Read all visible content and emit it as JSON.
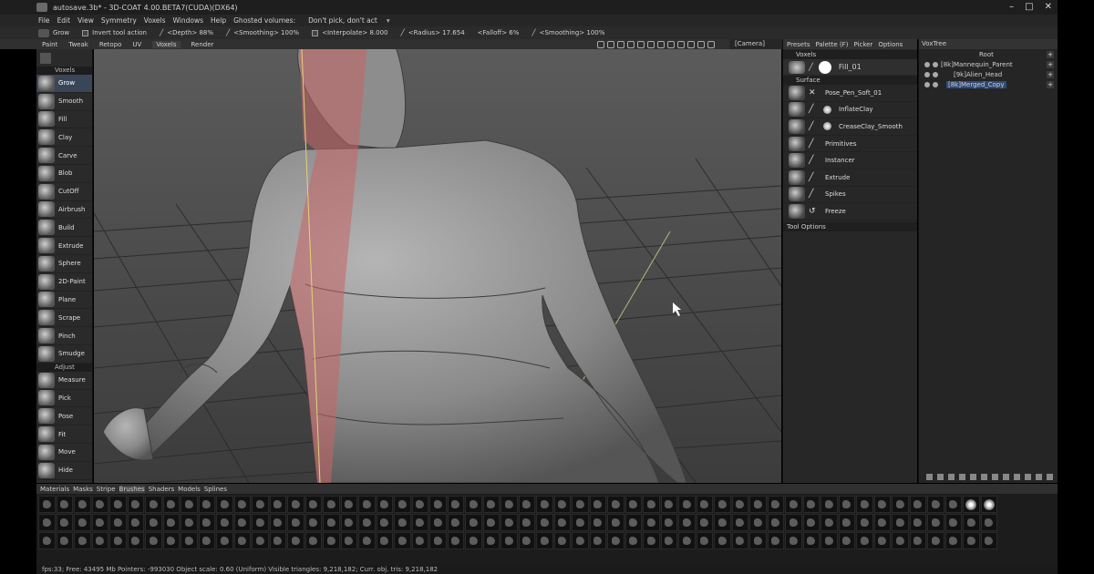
{
  "titlebar": {
    "title": "autosave.3b* - 3D-COAT 4.00.BETA7(CUDA)(DX64)",
    "minimize": "–",
    "maximize": "□",
    "close": "✕"
  },
  "menu": {
    "items": [
      "File",
      "Edit",
      "View",
      "Symmetry",
      "Voxels",
      "Windows",
      "Help"
    ],
    "ghosted_label": "Ghosted volumes:",
    "ghosted_value": "Don't pick, don't act"
  },
  "tool_options": {
    "tool_name": "Grow",
    "invert": "Invert tool action",
    "depth": "<Depth> 88%",
    "smoothing": "<Smoothing> 100%",
    "interpolate": "<Interpolate> 8.000",
    "radius": "<Radius> 17.654",
    "falloff": "<Falloff> 6%",
    "smoothing2": "<Smoothing> 100%"
  },
  "room_tabs": [
    "Paint",
    "Tweak",
    "Retopo",
    "UV",
    "Voxels",
    "Render"
  ],
  "camera": "[Camera]",
  "left_panel": {
    "voxels_header": "Voxels",
    "voxel_tools": [
      "Grow",
      "Smooth",
      "Fill",
      "Clay",
      "Carve",
      "Blob",
      "CutOff",
      "Airbrush",
      "Build",
      "Extrude",
      "Sphere",
      "2D-Paint",
      "Plane",
      "Scrape",
      "Pinch",
      "Smudge"
    ],
    "adjust_header": "Adjust",
    "adjust_tools": [
      "Measure",
      "Pick",
      "Pose",
      "Fit",
      "Move",
      "Hide"
    ]
  },
  "right_panel": {
    "tabs": [
      "Presets",
      "Palette (F)",
      "Picker",
      "Options"
    ],
    "voxels_header": "Voxels",
    "fill_label": "Fill_01",
    "surface_header": "Surface",
    "brushes": [
      "Pose_Pen_Soft_01",
      "InflateClay",
      "CreaseClay_Smooth",
      "Primitives",
      "Instancer",
      "Extrude",
      "Spikes",
      "Freeze"
    ],
    "tool_options_header": "Tool Options"
  },
  "voxtree": {
    "title": "VoxTree",
    "root": "Root",
    "layers": [
      "[8k]Mannequin_Parent",
      "[9k]Alien_Head",
      "[8k]Merged_Copy"
    ],
    "selected": 2
  },
  "bottom_tabs": [
    "Materials",
    "Masks",
    "Stripe",
    "Brushes",
    "Shaders",
    "Models",
    "Splines"
  ],
  "active_bottom_tab": "Brushes",
  "status": "fps:33;  Free: 43495 Mb Pointers: -993030 Object scale: 0.60 (Uniform)  Visible triangles: 9,218,182; Curr. obj. tris: 9,218,182",
  "colors": {
    "accent_select": "#3a4658",
    "symmetry_plane": "#c86464",
    "viewport_top": "#5b5b5b",
    "viewport_bottom": "#3c3c3c"
  }
}
